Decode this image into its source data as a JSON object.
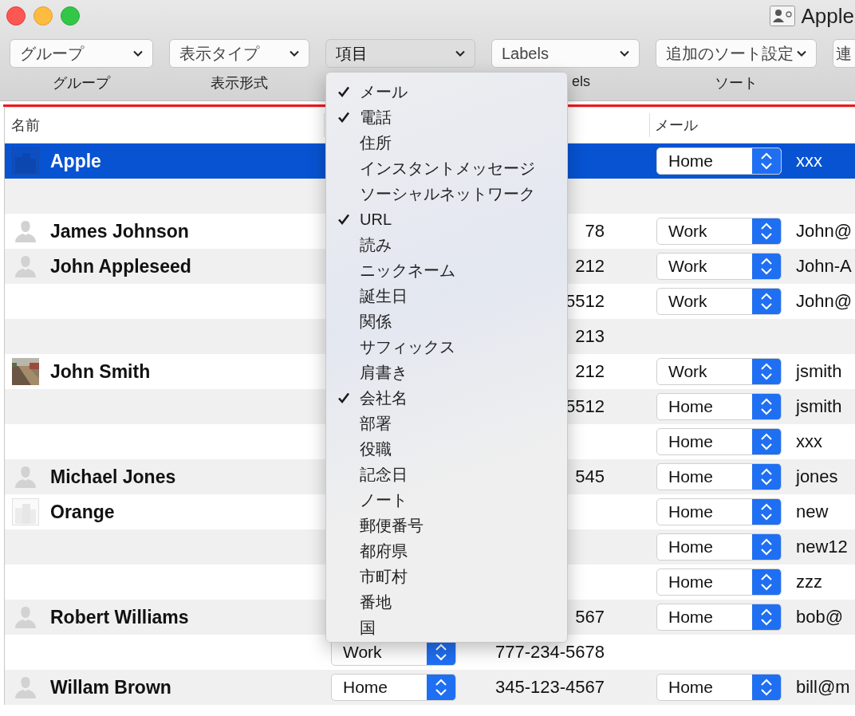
{
  "window": {
    "title": "Apple"
  },
  "toolbar": [
    {
      "value": "グループ",
      "label": "グループ",
      "pressed": false
    },
    {
      "value": "表示タイプ",
      "label": "表示形式",
      "pressed": false
    },
    {
      "value": "項目",
      "pressed": true
    },
    {
      "value": "Labels",
      "label": "els",
      "pressed": false
    },
    {
      "value": "追加のソート設定",
      "label": "ソート",
      "pressed": false
    },
    {
      "value": "連",
      "pressed": false
    }
  ],
  "table": {
    "columns": [
      "名前",
      "メール"
    ],
    "rows": [
      {
        "name": "Apple",
        "kind": "company",
        "selected": true,
        "email_label": "Home",
        "email": "xxx"
      },
      {
        "selected": false
      },
      {
        "name": "James Johnson",
        "kind": "person",
        "selected": false,
        "phone": "78",
        "email_label": "Work",
        "email": "John@"
      },
      {
        "name": "John Appleseed",
        "kind": "person",
        "selected": false,
        "phone": "212",
        "email_label": "Work",
        "email": "John-A"
      },
      {
        "selected": false,
        "phone": "5512",
        "email_label": "Work",
        "email": "John@"
      },
      {
        "selected": false,
        "phone": "213"
      },
      {
        "name": "John Smith",
        "selected": false,
        "phone": "212",
        "email_label": "Work",
        "email": "jsmith"
      },
      {
        "selected": false,
        "phone": "5512",
        "email_label": "Home",
        "email": "jsmith"
      },
      {
        "selected": false,
        "email_label": "Home",
        "email": "xxx"
      },
      {
        "name": "Michael Jones",
        "kind": "person",
        "selected": false,
        "phone": "545",
        "email_label": "Home",
        "email": "jones"
      },
      {
        "name": "Orange",
        "kind": "company",
        "selected": false,
        "email_label": "Home",
        "email": "new"
      },
      {
        "selected": false,
        "email_label": "Home",
        "email": "new12"
      },
      {
        "selected": false,
        "email_label": "Home",
        "email": "zzz"
      },
      {
        "name": "Robert Williams",
        "kind": "person",
        "selected": false,
        "phone": "567",
        "email_label": "Home",
        "email": "bob@"
      },
      {
        "selected": false,
        "phone_label": "Work",
        "phone": "777-234-5678"
      },
      {
        "name": "Willam Brown",
        "kind": "person",
        "selected": false,
        "phone_label": "Home",
        "phone": "345-123-4567",
        "email_label": "Home",
        "email": "bill@m"
      }
    ]
  },
  "menu": {
    "items": [
      {
        "label": "メール",
        "checked": true
      },
      {
        "label": "電話",
        "checked": true
      },
      {
        "label": "住所",
        "checked": false
      },
      {
        "label": "インスタントメッセージ",
        "checked": false
      },
      {
        "label": "ソーシャルネットワーク",
        "checked": false
      },
      {
        "label": "URL",
        "checked": true
      },
      {
        "label": "読み",
        "checked": false
      },
      {
        "label": "ニックネーム",
        "checked": false
      },
      {
        "label": "誕生日",
        "checked": false
      },
      {
        "label": "関係",
        "checked": false
      },
      {
        "label": "サフィックス",
        "checked": false
      },
      {
        "label": "肩書き",
        "checked": false
      },
      {
        "label": "会社名",
        "checked": true
      },
      {
        "label": "部署",
        "checked": false
      },
      {
        "label": "役職",
        "checked": false
      },
      {
        "label": "記念日",
        "checked": false
      },
      {
        "label": "ノート",
        "checked": false
      },
      {
        "label": "郵便番号",
        "checked": false
      },
      {
        "label": "都府県",
        "checked": false
      },
      {
        "label": "市町村",
        "checked": false
      },
      {
        "label": "番地",
        "checked": false
      },
      {
        "label": "国",
        "checked": false
      }
    ]
  }
}
